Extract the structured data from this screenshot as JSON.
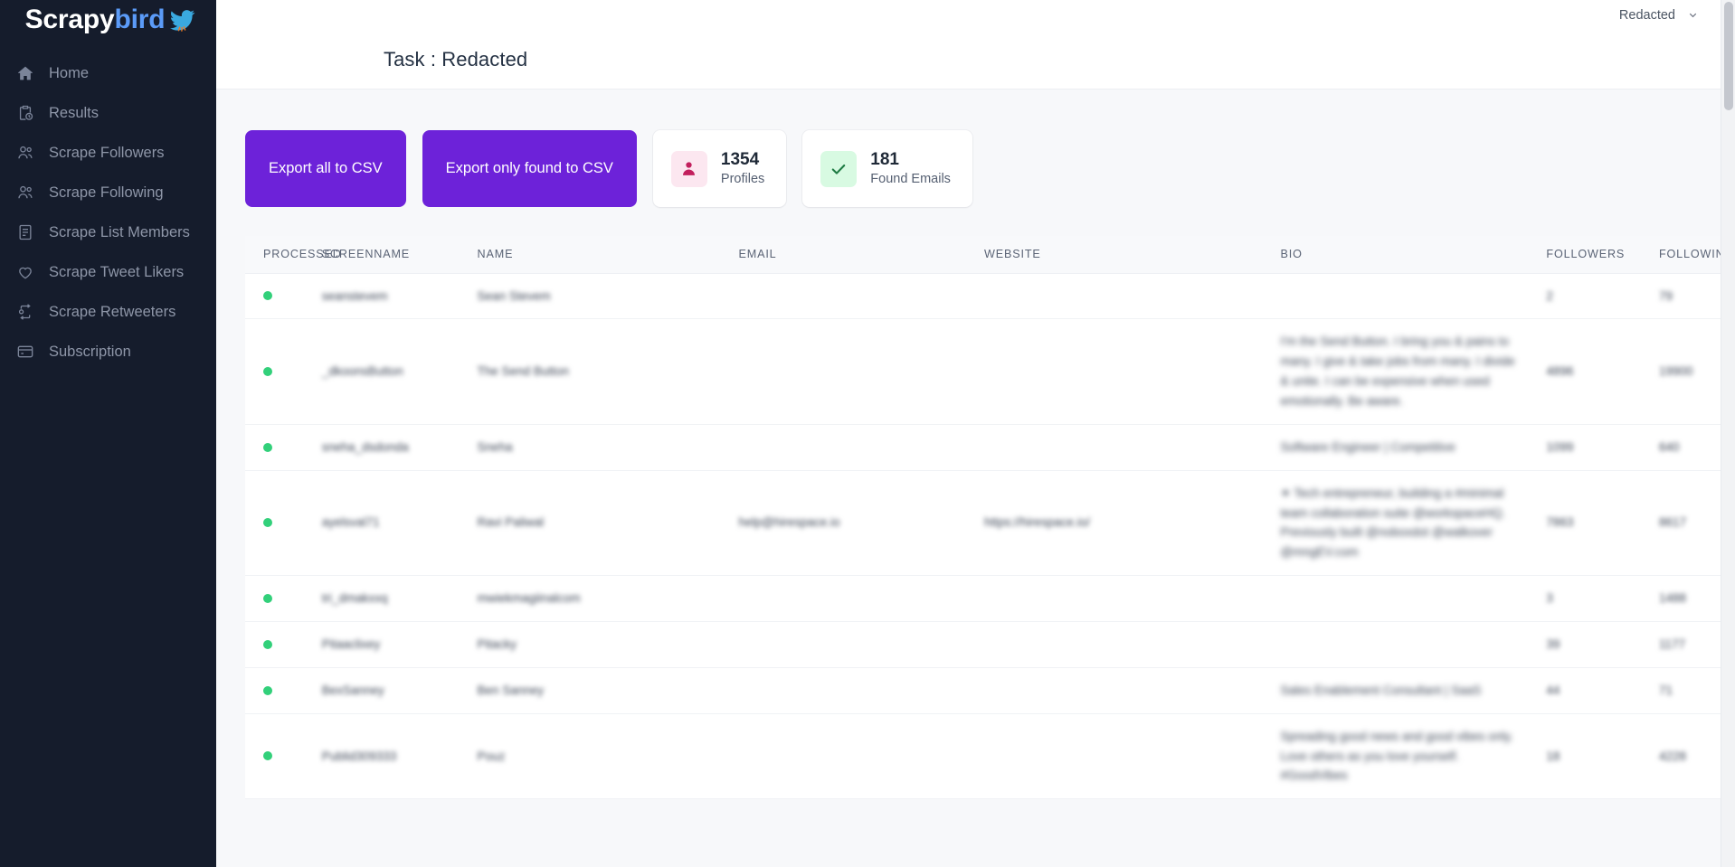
{
  "brand": {
    "name_part1": "Scrapy",
    "name_part2": "bird",
    "bird_icon": "bird-icon",
    "accent_blue": "#5b9bf8",
    "sidebar_bg": "#151c2c"
  },
  "sidebar": {
    "items": [
      {
        "label": "Home",
        "icon": "home-icon"
      },
      {
        "label": "Results",
        "icon": "clipboard-clock-icon"
      },
      {
        "label": "Scrape Followers",
        "icon": "users-icon"
      },
      {
        "label": "Scrape Following",
        "icon": "users-icon"
      },
      {
        "label": "Scrape List Members",
        "icon": "list-document-icon"
      },
      {
        "label": "Scrape Tweet Likers",
        "icon": "heart-icon"
      },
      {
        "label": "Scrape Retweeters",
        "icon": "retweet-icon"
      },
      {
        "label": "Subscription",
        "icon": "credit-card-icon"
      }
    ]
  },
  "topbar": {
    "account_label": "Redacted",
    "caret_icon": "chevron-down-icon"
  },
  "header": {
    "title": "Task : Redacted"
  },
  "actions": {
    "export_all_label": "Export all to CSV",
    "export_found_label": "Export only found to CSV",
    "purple": "#6d22d9"
  },
  "stats": [
    {
      "value": "1354",
      "label": "Profiles",
      "icon": "person-icon",
      "icon_bg": "#fce7f0",
      "icon_color": "#c21f5d"
    },
    {
      "value": "181",
      "label": "Found Emails",
      "icon": "check-icon",
      "icon_bg": "#d8fae2",
      "icon_color": "#1e7b43"
    }
  ],
  "table": {
    "columns": [
      "PROCESSED",
      "SCREENNAME",
      "NAME",
      "EMAIL",
      "WEBSITE",
      "BIO",
      "FOLLOWERS",
      "FOLLOWING"
    ],
    "status_color": "#32d07a",
    "rows": [
      {
        "processed": true,
        "screenname": "seanstevem",
        "name": "Sean Stevem",
        "email": "",
        "website": "",
        "bio": "",
        "followers": "2",
        "following": "79"
      },
      {
        "processed": true,
        "screenname": "_dkoonsButton",
        "name": "The Send Button",
        "email": "",
        "website": "",
        "bio": "I'm the Send Button. I bring you & pains to many. I give & take jobs from many. I divide & unite. I can be expensive when used emotionally. Be aware.",
        "followers": "4896",
        "following": "19900"
      },
      {
        "processed": true,
        "screenname": "sneha_dsdonda",
        "name": "Sneha",
        "email": "",
        "website": "",
        "bio": "Software Engineer | Competitive",
        "followers": "1099",
        "following": "640"
      },
      {
        "processed": true,
        "screenname": "ayelsval71",
        "name": "Ravi Paliwal",
        "email": "help@hirespace.io",
        "website": "https://hirespace.io/",
        "bio": "✦ Tech entrepreneur, building a #minimal team collaboration suite @workspaceHQ. Previously built @noboxdot @walkover @mngEV.com",
        "followers": "7863",
        "following": "8617"
      },
      {
        "processed": true,
        "screenname": "tri_dmakxxq",
        "name": "mwiekmagiinalcom",
        "email": "",
        "website": "",
        "bio": "",
        "followers": "3",
        "following": "1488"
      },
      {
        "processed": true,
        "screenname": "Pitaaclixey",
        "name": "Pitacky",
        "email": "",
        "website": "",
        "bio": "",
        "followers": "39",
        "following": "1177"
      },
      {
        "processed": true,
        "screenname": "BexSanney",
        "name": "Ben Sanney",
        "email": "",
        "website": "",
        "bio": "Sales Enablement Consultant | SaaS",
        "followers": "44",
        "following": "71"
      },
      {
        "processed": true,
        "screenname": "Publid309333",
        "name": "Pouz",
        "email": "",
        "website": "",
        "bio": "Spreading good news and good vibes only. Love others as you love yourself. #GoodVibes",
        "followers": "18",
        "following": "4228"
      }
    ]
  }
}
